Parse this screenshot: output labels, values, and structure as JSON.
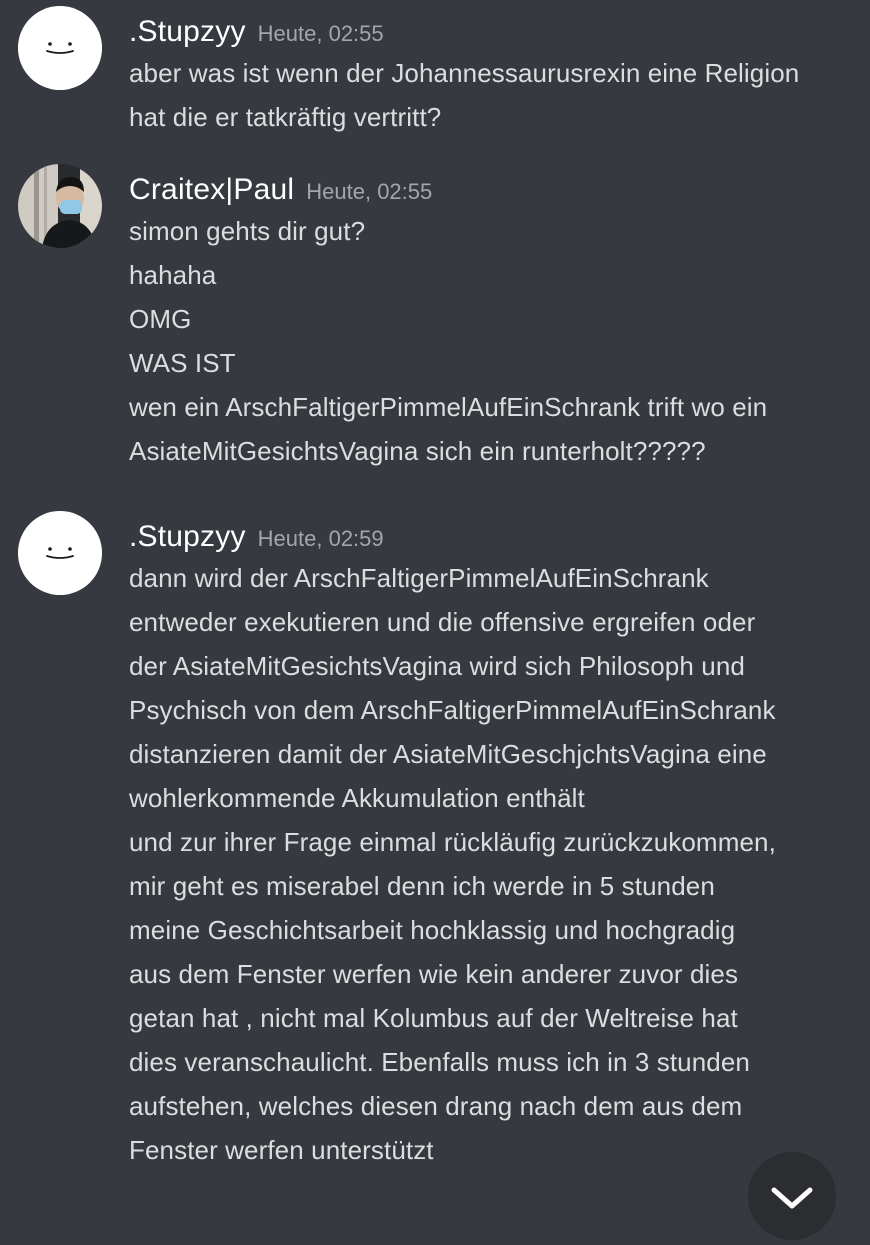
{
  "messages": [
    {
      "author": ".Stupzyy",
      "timestamp": "Heute, 02:55",
      "avatar": "smiley-face-icon",
      "lines": [
        "aber was ist wenn der Johannessaurusrexin eine Religion",
        "hat die er tatkräftig vertritt?"
      ]
    },
    {
      "author": "Craitex|Paul",
      "timestamp": "Heute, 02:55",
      "avatar": "profile-photo",
      "lines": [
        "simon gehts dir gut?",
        "hahaha",
        "OMG",
        "WAS IST",
        "wen ein ArschFaltigerPimmelAufEinSchrank trift wo ein",
        "AsiateMitGesichtsVagina sich ein runterholt?????"
      ]
    },
    {
      "author": ".Stupzyy",
      "timestamp": "Heute, 02:59",
      "avatar": "smiley-face-icon",
      "lines": [
        "dann wird der ArschFaltigerPimmelAufEinSchrank",
        "entweder exekutieren und die offensive ergreifen oder",
        "der AsiateMitGesichtsVagina wird sich Philosoph und",
        "Psychisch von dem ArschFaltigerPimmelAufEinSchrank",
        "distanzieren damit der AsiateMitGeschjchtsVagina eine",
        "wohlerkommende Akkumulation enthält",
        "und zur ihrer Frage einmal rückläufig zurückzukommen,",
        "mir geht es miserabel denn ich werde in 5 stunden",
        "meine Geschichtsarbeit hochklassig und hochgradig",
        "aus dem Fenster werfen wie kein anderer zuvor dies",
        "getan hat , nicht mal Kolumbus auf der Weltreise hat",
        "dies veranschaulicht. Ebenfalls muss ich in 3 stunden",
        "aufstehen, welches diesen drang nach dem aus dem",
        "Fenster werfen unterstützt"
      ]
    }
  ],
  "scroll_button": {
    "icon": "chevron-down-icon"
  },
  "colors": {
    "background": "#36393f",
    "username": "#ffffff",
    "timestamp": "#a3a6aa",
    "message_text": "#dcddde",
    "scroll_button": "#2b2d31"
  }
}
